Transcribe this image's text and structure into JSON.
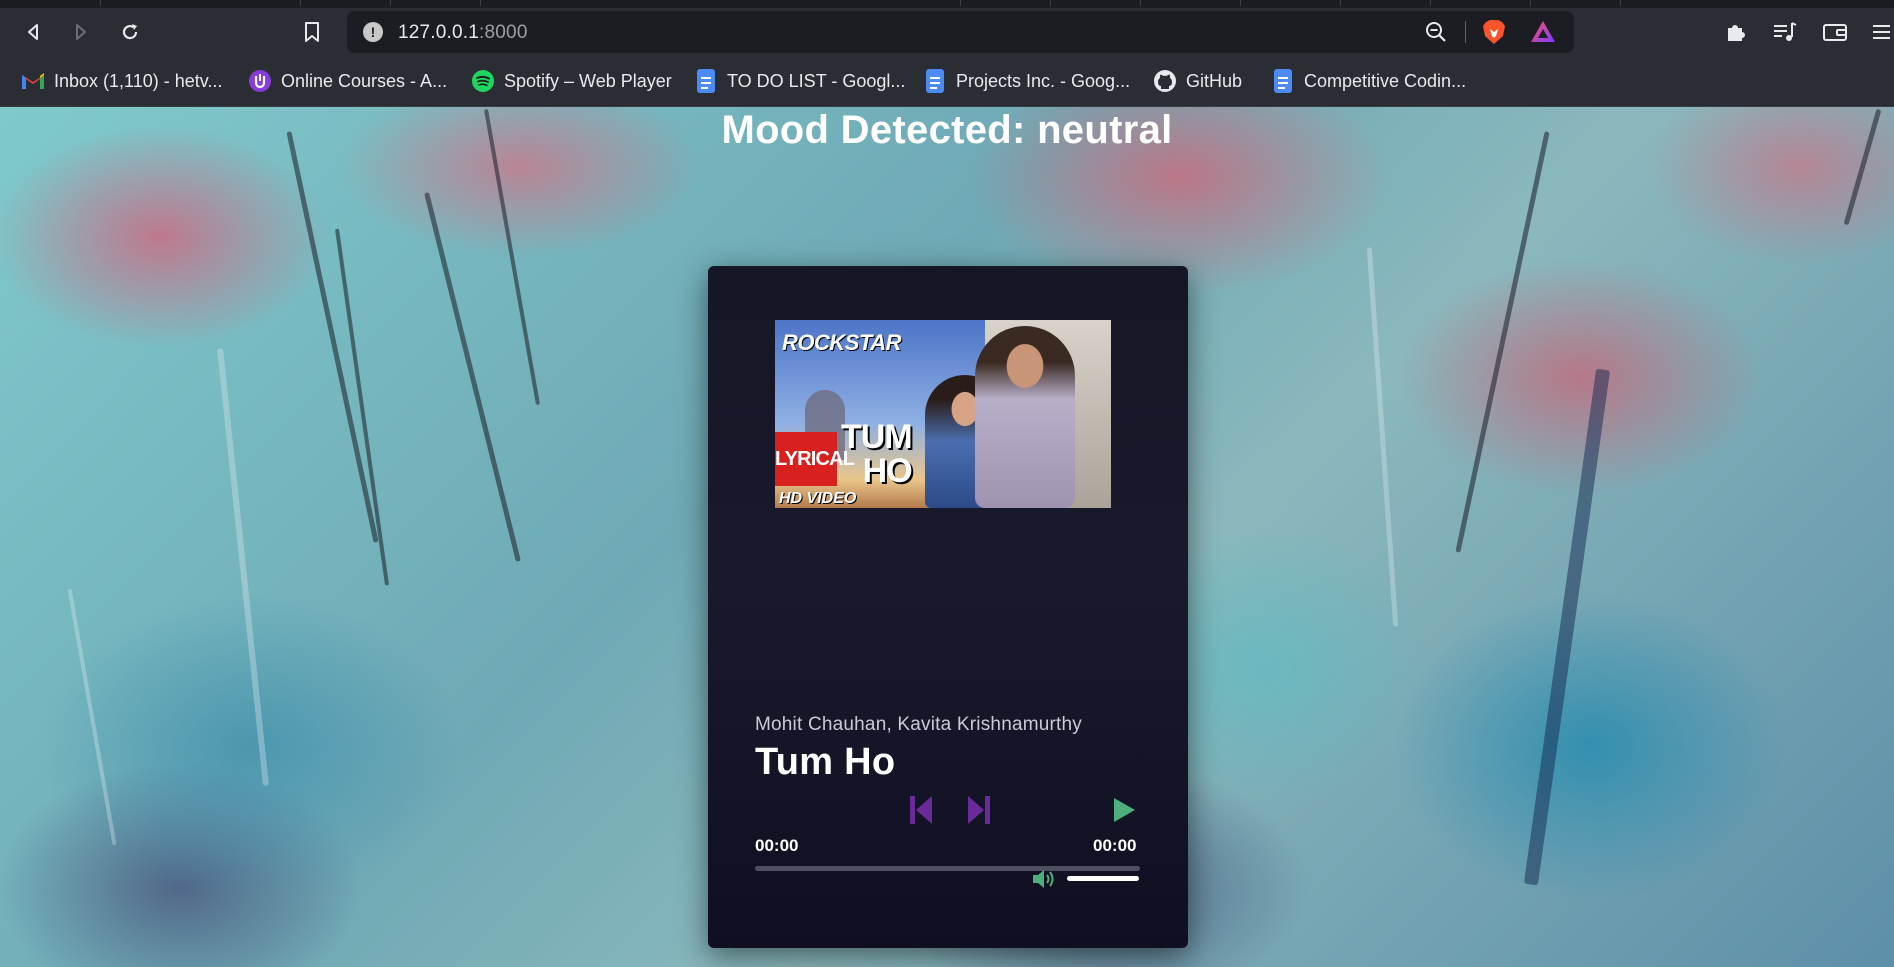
{
  "browser": {
    "url_host": "127.0.0.1",
    "url_port": ":8000",
    "bookmarks": [
      {
        "label": "Inbox (1,110) - hetv...",
        "icon": "gmail-icon"
      },
      {
        "label": "Online Courses - A...",
        "icon": "courses-icon"
      },
      {
        "label": "Spotify – Web Player",
        "icon": "spotify-icon"
      },
      {
        "label": "TO DO LIST - Googl...",
        "icon": "google-docs-icon"
      },
      {
        "label": "Projects Inc. - Goog...",
        "icon": "google-docs-icon"
      },
      {
        "label": "GitHub",
        "icon": "github-icon"
      },
      {
        "label": "Competitive Codin...",
        "icon": "google-docs-icon"
      }
    ]
  },
  "page": {
    "mood_title": "Mood Detected: neutral"
  },
  "player": {
    "cover": {
      "logo_text": "ROCKSTAR",
      "lyrical_text": "LYRICAL",
      "title_line1": "TUM",
      "title_line2": "HO",
      "hd_text": "HD VIDEO"
    },
    "artist": "Mohit Chauhan, Kavita Krishnamurthy",
    "title": "Tum Ho",
    "current_time": "00:00",
    "duration": "00:00",
    "progress": 0,
    "colors": {
      "nav_controls": "#6a2a9a",
      "play": "#4caf7d",
      "volume": "#4caf7d"
    }
  }
}
